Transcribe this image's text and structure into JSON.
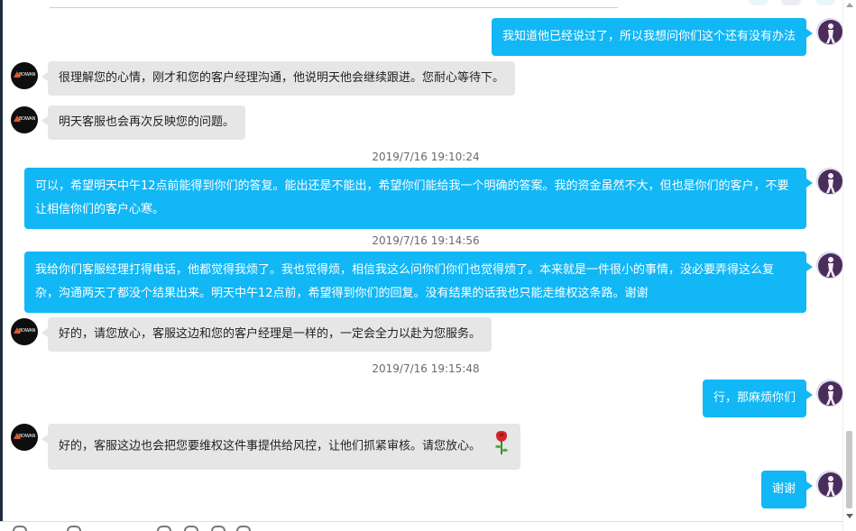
{
  "messages": [
    {
      "from": "user",
      "text": "我知道他已经说过了，所以我想问你们这个还有没有办法"
    },
    {
      "from": "agent",
      "text": "很理解您的心情，刚才和您的客户经理沟通，他说明天他会继续跟进。您耐心等待下。"
    },
    {
      "from": "agent",
      "text": "明天客服也会再次反映您的问题。"
    },
    {
      "timestamp": "2019/7/16 19:10:24"
    },
    {
      "from": "user",
      "text": "可以，希望明天中午12点前能得到你们的答复。能出还是不能出，希望你们能给我一个明确的答案。我的资金虽然不大，但也是你们的客户，不要让相信你们的客户心寒。"
    },
    {
      "timestamp": "2019/7/16 19:14:56"
    },
    {
      "from": "user",
      "text": "我给你们客服经理打得电话，他都觉得我烦了。我也觉得烦，相信我这么问你们你们也觉得烦了。本来就是一件很小的事情，没必要弄得这么复杂，沟通两天了都没个结果出来。明天中午12点前，希望得到你们的回复。没有结果的话我也只能走维权这条路。谢谢"
    },
    {
      "from": "agent",
      "text": "好的，请您放心，客服这边和您的客户经理是一样的，一定会全力以赴为您服务。"
    },
    {
      "timestamp": "2019/7/16 19:15:48"
    },
    {
      "from": "user",
      "text": "行，那麻烦你们"
    },
    {
      "from": "agent",
      "text": "好的，客服这边也会把您要维权这件事提供给风控，让他们抓紧审核。请您放心。",
      "emoji": "rose"
    },
    {
      "from": "user",
      "text": "谢谢"
    }
  ],
  "agent_avatar": {
    "brand_text": "BOWAN"
  },
  "colors": {
    "outgoing_bubble": "#12b7f5",
    "incoming_bubble": "#e6e6e6",
    "timestamp_text": "#6a6a6a"
  }
}
